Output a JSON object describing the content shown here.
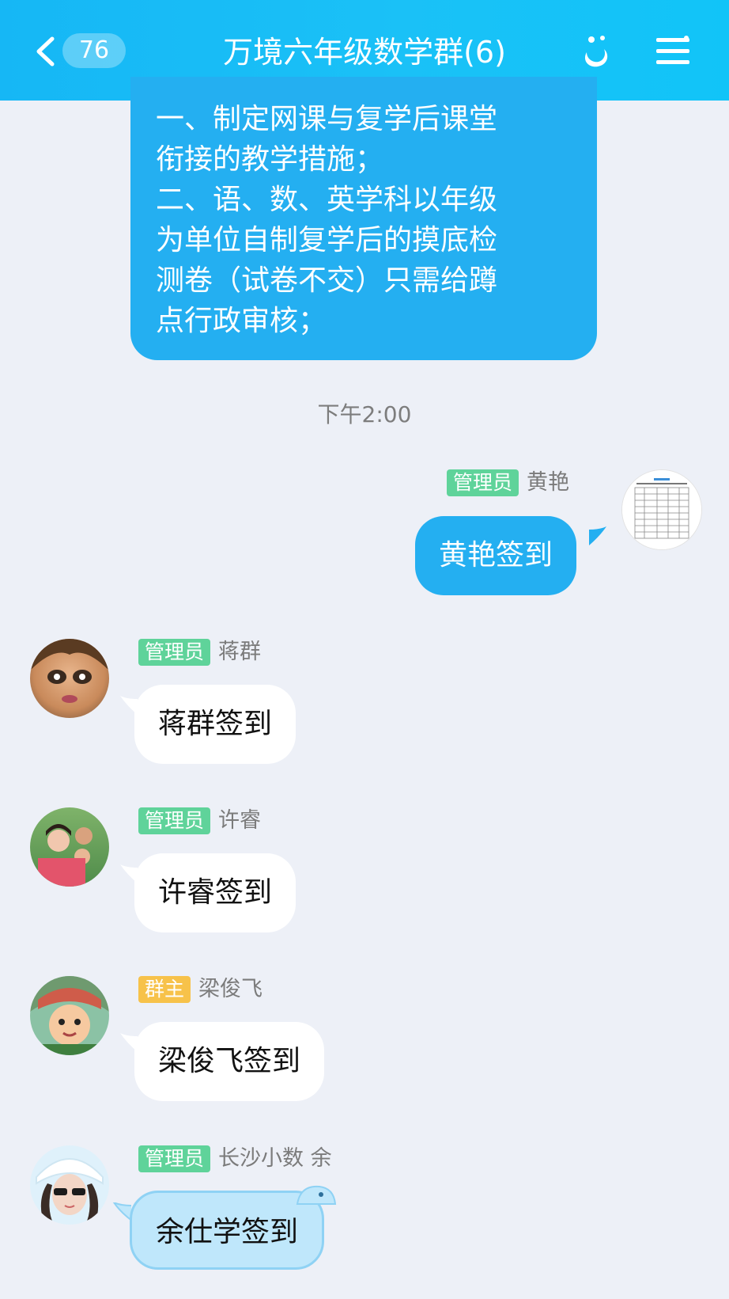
{
  "header": {
    "badge_count": "76",
    "title": "万境六年级数学群(6)",
    "colors": {
      "header": "#1ab9f6",
      "text": "#ffffff"
    }
  },
  "messages": [
    {
      "lines": [
        "一、制定网课与复学后课堂",
        "衔接的教学措施；",
        "二、语、数、英学科以年级",
        "为单位自制复学后的摸底检",
        "测卷（试卷不交）只需给蹲",
        "点行政审核；"
      ]
    }
  ],
  "timestamp": "下午2:00",
  "chat": [
    {
      "role": "管理员",
      "name": "黄艳",
      "text": "黄艳签到"
    },
    {
      "role": "管理员",
      "name": "蒋群",
      "text": "蒋群签到"
    },
    {
      "role": "管理员",
      "name": "许睿",
      "text": "许睿签到"
    },
    {
      "role": "群主",
      "name": "梁俊飞",
      "text": "梁俊飞签到"
    },
    {
      "role": "管理员",
      "name": "长沙小数  余",
      "text": "余仕学签到"
    }
  ],
  "colors": {
    "background": "#edf0f7",
    "self_bubble": "#24aff1",
    "other_bubble": "#ffffff",
    "admin_tag": "#5fd39a",
    "owner_tag": "#f7c24a"
  }
}
